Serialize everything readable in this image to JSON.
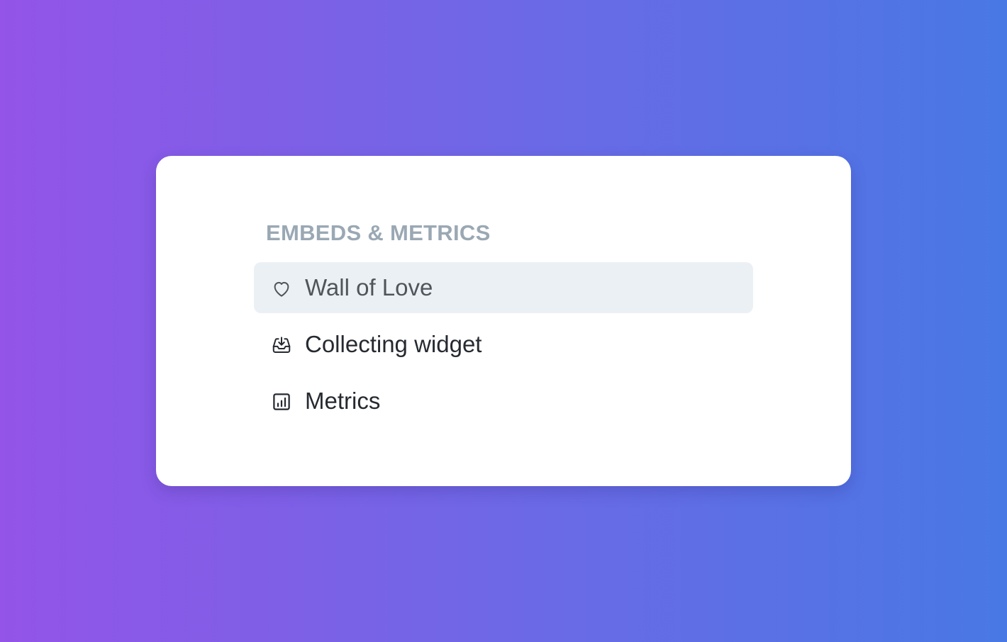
{
  "colors": {
    "background_start": "#9354E7",
    "background_end": "#4878E4",
    "card": "#FFFFFF",
    "section_title": "#9AA8B4",
    "active_item_bg": "#EBF0F4",
    "text": "#262A30"
  },
  "section": {
    "title": "EMBEDS & METRICS"
  },
  "menu": {
    "items": [
      {
        "label": "Wall of Love",
        "icon": "heart-icon",
        "active": true
      },
      {
        "label": "Collecting widget",
        "icon": "inbox-download-icon",
        "active": false
      },
      {
        "label": "Metrics",
        "icon": "bar-chart-icon",
        "active": false
      }
    ]
  }
}
